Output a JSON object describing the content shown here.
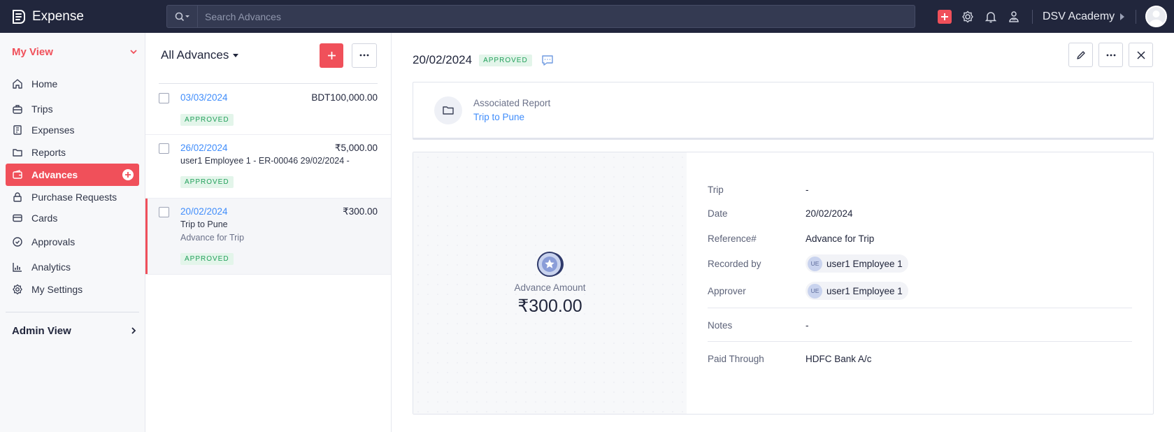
{
  "app": {
    "name": "Expense"
  },
  "search": {
    "placeholder": "Search Advances"
  },
  "header": {
    "org_name": "DSV Academy"
  },
  "sidebar": {
    "my_view_label": "My View",
    "items": [
      {
        "label": "Home",
        "icon": "home-icon"
      },
      {
        "label": "Trips",
        "icon": "suitcase-icon"
      },
      {
        "label": "Expenses",
        "icon": "receipt-icon"
      },
      {
        "label": "Reports",
        "icon": "folder-icon"
      },
      {
        "label": "Advances",
        "icon": "wallet-icon",
        "active": true
      },
      {
        "label": "Purchase Requests",
        "icon": "lock-icon"
      },
      {
        "label": "Cards",
        "icon": "card-icon"
      },
      {
        "label": "Approvals",
        "icon": "check-circle-icon"
      },
      {
        "label": "Analytics",
        "icon": "bar-chart-icon"
      },
      {
        "label": "My Settings",
        "icon": "gear-icon"
      }
    ],
    "admin_view_label": "Admin View"
  },
  "list": {
    "title": "All Advances",
    "rows": [
      {
        "date": "03/03/2024",
        "amount": "BDT100,000.00",
        "status": "APPROVED"
      },
      {
        "date": "26/02/2024",
        "amount": "₹5,000.00",
        "line1": "user1 Employee 1 - ER-00046 29/02/2024 -",
        "status": "APPROVED"
      },
      {
        "date": "20/02/2024",
        "amount": "₹300.00",
        "line1": "Trip to Pune",
        "line2": "Advance for Trip",
        "status": "APPROVED"
      }
    ]
  },
  "detail": {
    "date": "20/02/2024",
    "status": "APPROVED",
    "associated_label": "Associated Report",
    "associated_value": "Trip to Pune",
    "amount_label": "Advance Amount",
    "amount_value": "₹300.00",
    "fields": {
      "trip_k": "Trip",
      "trip_v": "-",
      "date_k": "Date",
      "date_v": "20/02/2024",
      "ref_k": "Reference#",
      "ref_v": "Advance for Trip",
      "rec_k": "Recorded by",
      "rec_v": "user1 Employee 1",
      "rec_initials": "UE",
      "appr_k": "Approver",
      "appr_v": "user1 Employee 1",
      "appr_initials": "UE",
      "notes_k": "Notes",
      "notes_v": "-",
      "paid_k": "Paid Through",
      "paid_v": "HDFC Bank A/c"
    }
  },
  "colors": {
    "accent": "#f0505a",
    "link": "#408dfb",
    "topbar": "#21263c",
    "approved_bg": "#e3f5ea",
    "approved_fg": "#22a05b"
  }
}
